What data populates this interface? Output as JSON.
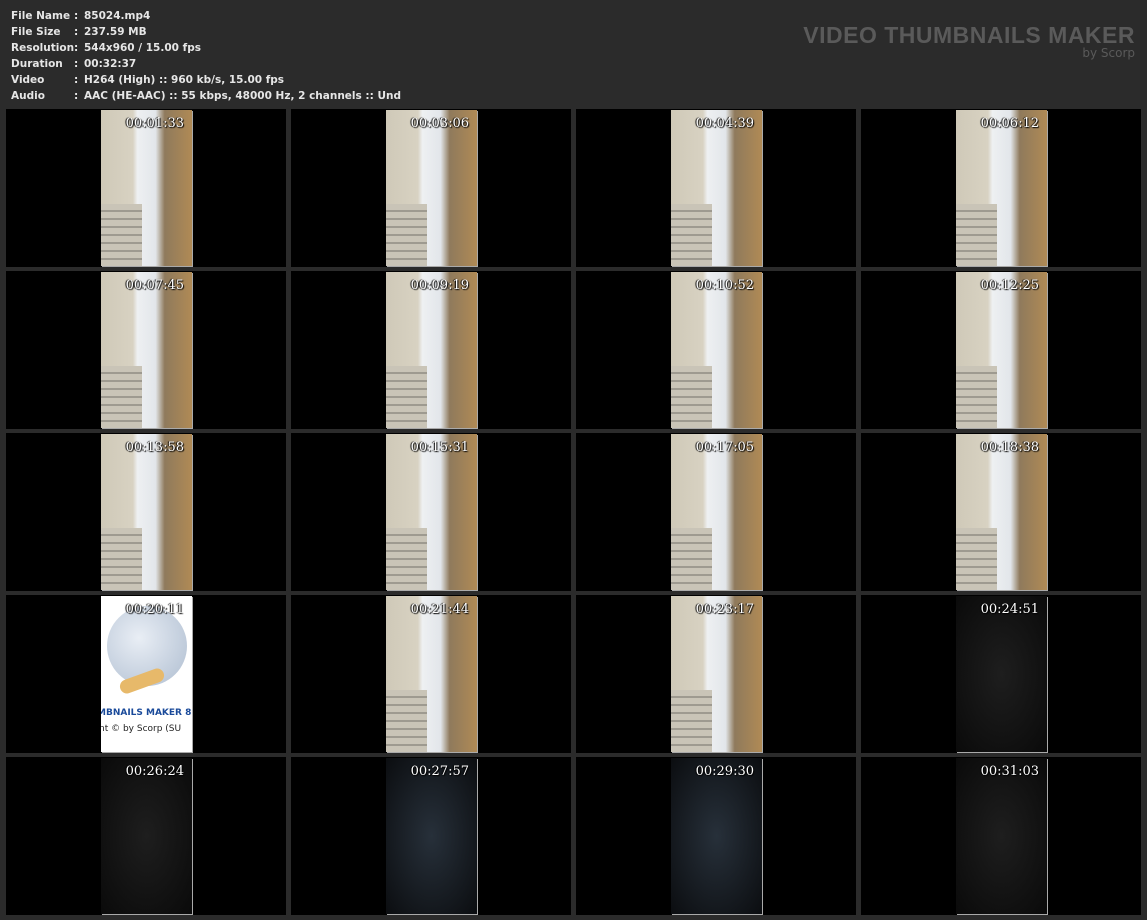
{
  "info": [
    {
      "label": "File Name",
      "value": "85024.mp4"
    },
    {
      "label": "File Size",
      "value": "237.59 MB"
    },
    {
      "label": "Resolution",
      "value": "544x960 / 15.00 fps"
    },
    {
      "label": "Duration",
      "value": "00:32:37"
    },
    {
      "label": "Video",
      "value": "H264 (High) :: 960 kb/s, 15.00 fps"
    },
    {
      "label": "Audio",
      "value": "AAC (HE-AAC) :: 55 kbps, 48000 Hz, 2 channels :: Und"
    }
  ],
  "separator": ":",
  "brand": {
    "title": "VIDEO THUMBNAILS MAKER",
    "subtitle": "by Scorp"
  },
  "logo_frame": {
    "line1": "MBNAILS MAKER 8",
    "line2": "nt © by Scorp (SU"
  },
  "thumbnails": [
    {
      "time": "00:01:33",
      "style": "room"
    },
    {
      "time": "00:03:06",
      "style": "room"
    },
    {
      "time": "00:04:39",
      "style": "room"
    },
    {
      "time": "00:06:12",
      "style": "room"
    },
    {
      "time": "00:07:45",
      "style": "room"
    },
    {
      "time": "00:09:19",
      "style": "room"
    },
    {
      "time": "00:10:52",
      "style": "room"
    },
    {
      "time": "00:12:25",
      "style": "room"
    },
    {
      "time": "00:13:58",
      "style": "room"
    },
    {
      "time": "00:15:31",
      "style": "room"
    },
    {
      "time": "00:17:05",
      "style": "room"
    },
    {
      "time": "00:18:38",
      "style": "room"
    },
    {
      "time": "00:20:11",
      "style": "logo"
    },
    {
      "time": "00:21:44",
      "style": "room"
    },
    {
      "time": "00:23:17",
      "style": "room"
    },
    {
      "time": "00:24:51",
      "style": "dark"
    },
    {
      "time": "00:26:24",
      "style": "dark"
    },
    {
      "time": "00:27:57",
      "style": "blue"
    },
    {
      "time": "00:29:30",
      "style": "blue"
    },
    {
      "time": "00:31:03",
      "style": "dark"
    }
  ]
}
